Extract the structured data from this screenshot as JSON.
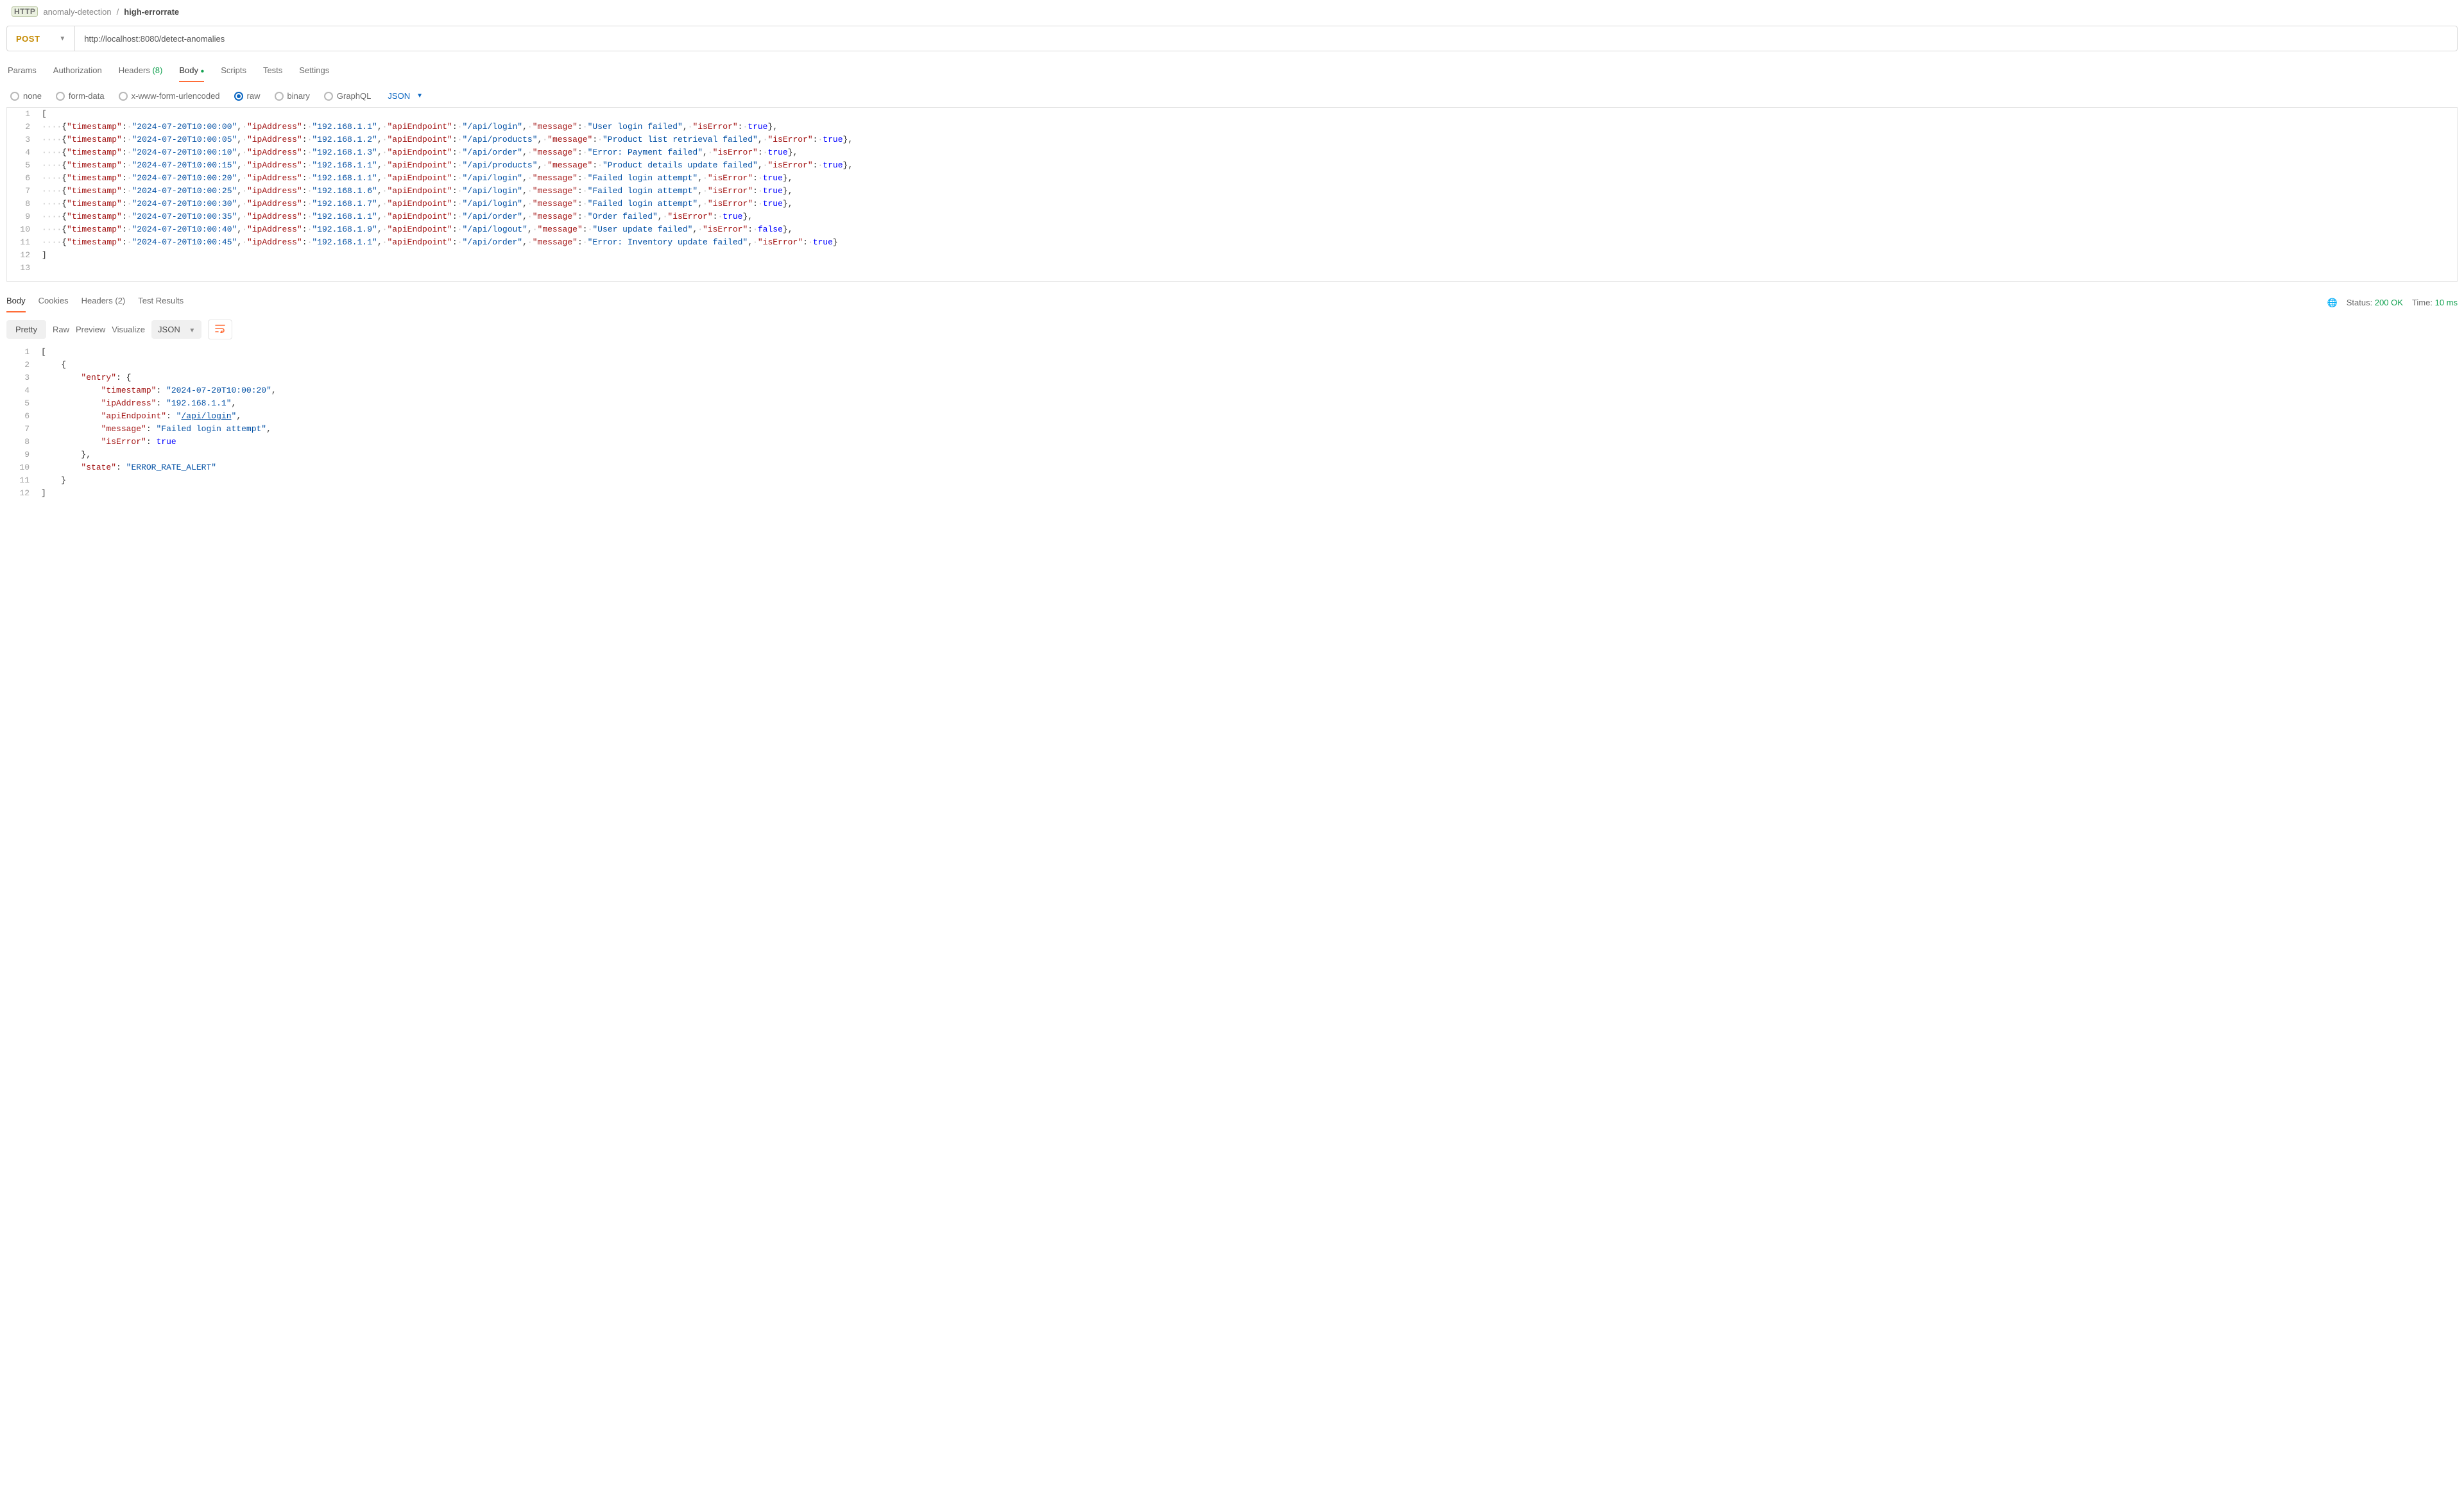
{
  "breadcrumb": {
    "collection": "anomaly-detection",
    "sep": "/",
    "current": "high-errorrate",
    "httpBadge": "HTTP"
  },
  "request": {
    "method": "POST",
    "url": "http://localhost:8080/detect-anomalies"
  },
  "reqTabs": {
    "params": "Params",
    "auth": "Authorization",
    "headers": "Headers",
    "headersCount": "(8)",
    "body": "Body",
    "scripts": "Scripts",
    "tests": "Tests",
    "settings": "Settings"
  },
  "bodyType": {
    "none": "none",
    "formData": "form-data",
    "urlencoded": "x-www-form-urlencoded",
    "raw": "raw",
    "binary": "binary",
    "graphql": "GraphQL",
    "lang": "JSON"
  },
  "requestBody": [
    {
      "timestamp": "2024-07-20T10:00:00",
      "ipAddress": "192.168.1.1",
      "apiEndpoint": "/api/login",
      "message": "User login failed",
      "isError": true
    },
    {
      "timestamp": "2024-07-20T10:00:05",
      "ipAddress": "192.168.1.2",
      "apiEndpoint": "/api/products",
      "message": "Product list retrieval failed",
      "isError": true
    },
    {
      "timestamp": "2024-07-20T10:00:10",
      "ipAddress": "192.168.1.3",
      "apiEndpoint": "/api/order",
      "message": "Error: Payment failed",
      "isError": true
    },
    {
      "timestamp": "2024-07-20T10:00:15",
      "ipAddress": "192.168.1.1",
      "apiEndpoint": "/api/products",
      "message": "Product details update failed",
      "isError": true
    },
    {
      "timestamp": "2024-07-20T10:00:20",
      "ipAddress": "192.168.1.1",
      "apiEndpoint": "/api/login",
      "message": "Failed login attempt",
      "isError": true
    },
    {
      "timestamp": "2024-07-20T10:00:25",
      "ipAddress": "192.168.1.6",
      "apiEndpoint": "/api/login",
      "message": "Failed login attempt",
      "isError": true
    },
    {
      "timestamp": "2024-07-20T10:00:30",
      "ipAddress": "192.168.1.7",
      "apiEndpoint": "/api/login",
      "message": "Failed login attempt",
      "isError": true
    },
    {
      "timestamp": "2024-07-20T10:00:35",
      "ipAddress": "192.168.1.1",
      "apiEndpoint": "/api/order",
      "message": "Order failed",
      "isError": true
    },
    {
      "timestamp": "2024-07-20T10:00:40",
      "ipAddress": "192.168.1.9",
      "apiEndpoint": "/api/logout",
      "message": "User update failed",
      "isError": false
    },
    {
      "timestamp": "2024-07-20T10:00:45",
      "ipAddress": "192.168.1.1",
      "apiEndpoint": "/api/order",
      "message": "Error: Inventory update failed",
      "isError": true
    }
  ],
  "respTabs": {
    "body": "Body",
    "cookies": "Cookies",
    "headers": "Headers",
    "headersCount": "(2)",
    "testResults": "Test Results"
  },
  "status": {
    "label": "Status:",
    "value": "200 OK",
    "timeLabel": "Time:",
    "timeValue": "10 ms"
  },
  "respToolbar": {
    "pretty": "Pretty",
    "raw": "Raw",
    "preview": "Preview",
    "visualize": "Visualize",
    "format": "JSON"
  },
  "responseBody": [
    {
      "entry": {
        "timestamp": "2024-07-20T10:00:20",
        "ipAddress": "192.168.1.1",
        "apiEndpoint": "/api/login",
        "message": "Failed login attempt",
        "isError": true
      },
      "state": "ERROR_RATE_ALERT"
    }
  ]
}
